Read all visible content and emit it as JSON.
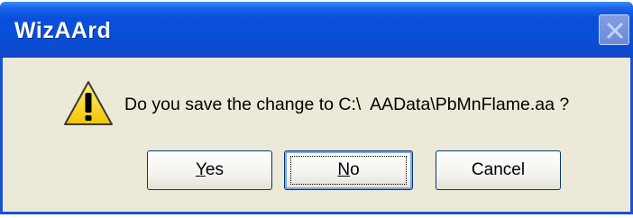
{
  "window": {
    "title": "WizAArd"
  },
  "icons": {
    "warning": "warning-icon",
    "close": "close-icon"
  },
  "message": {
    "text": "Do you save the change to C:\\  AAData\\PbMnFlame.aa ?"
  },
  "buttons": {
    "yes": {
      "mnemonic": "Y",
      "rest": "es"
    },
    "no": {
      "mnemonic": "N",
      "rest": "o"
    },
    "cancel": {
      "label": "Cancel"
    }
  },
  "colors": {
    "title_bar": "#0a4fdc",
    "dialog_bg": "#ece9d8",
    "warning_fill": "#f7d720"
  }
}
